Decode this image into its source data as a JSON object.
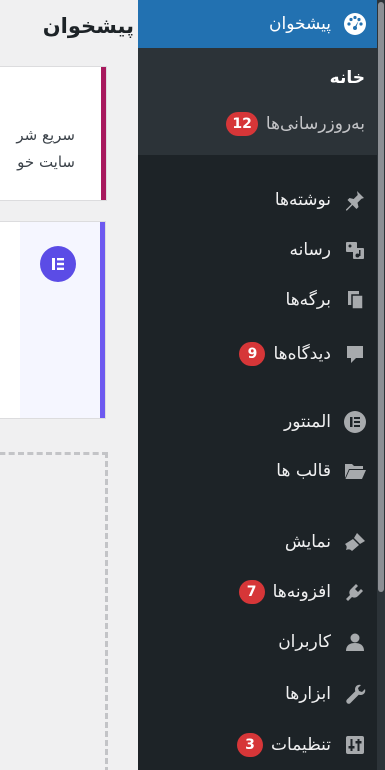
{
  "page": {
    "title": "پیشخوان"
  },
  "welcome_card": {
    "line1": "سریع شر",
    "line2": "سایت خو"
  },
  "sidebar": {
    "dashboard": {
      "label": "پیشخوان",
      "icon": "gauge-icon"
    },
    "submenu": [
      {
        "label": "خانه"
      },
      {
        "label": "به‌روزرسانی‌ها",
        "badge": "12"
      }
    ],
    "items": [
      {
        "label": "نوشته‌ها",
        "icon": "pin-icon"
      },
      {
        "label": "رسانه",
        "icon": "media-icon"
      },
      {
        "label": "برگه‌ها",
        "icon": "pages-icon"
      },
      {
        "label": "دیدگاه‌ها",
        "icon": "comments-icon",
        "badge": "9"
      },
      {
        "label": "المنتور",
        "icon": "elementor-icon"
      },
      {
        "label": "قالب ها",
        "icon": "folder-icon"
      },
      {
        "label": "نمایش",
        "icon": "brush-icon"
      },
      {
        "label": "افزونه‌ها",
        "icon": "plugin-icon",
        "badge": "7"
      },
      {
        "label": "کاربران",
        "icon": "user-icon"
      },
      {
        "label": "ابزارها",
        "icon": "wrench-icon"
      },
      {
        "label": "تنظیمات",
        "icon": "settings-icon",
        "badge": "3"
      }
    ]
  },
  "colors": {
    "sidebar_bg": "#1d2327",
    "submenu_bg": "#2c3338",
    "active": "#2271b1",
    "badge": "#d63638",
    "elementor": "#5b4ce6",
    "card_accent": "#a8195e"
  }
}
